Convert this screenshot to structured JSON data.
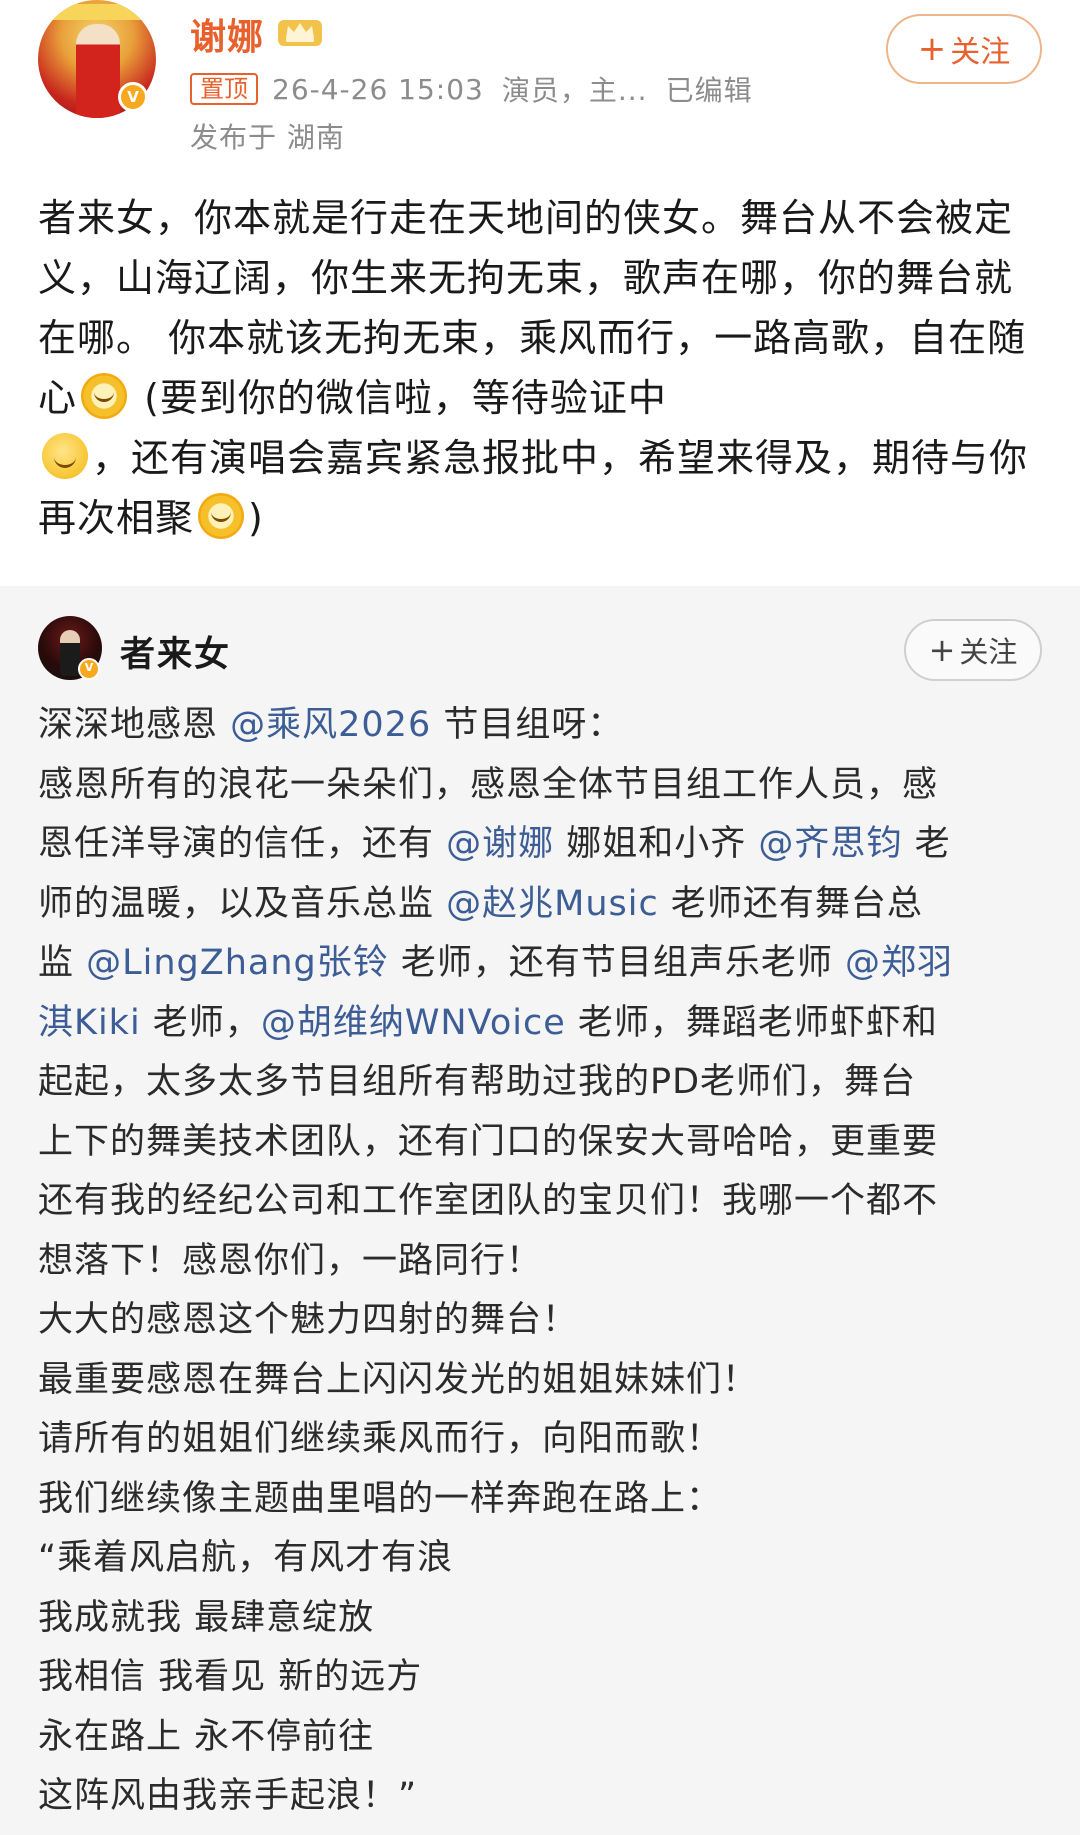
{
  "post": {
    "username": "谢娜",
    "pin_label": "置顶",
    "timestamp": "26-4-26 15:03",
    "tagline": "演员，主...",
    "edited_label": "已编辑",
    "location": "发布于 湖南",
    "follow_label": "关注",
    "follow_plus": "+",
    "body": {
      "seg1": "者来女，你本就是行走在天地间的侠女。舞台从不会被定义，山海辽阔，你生来无拘无束，歌声在哪，你的舞台就在哪。 你本就该无拘无束，乘风而行，一路高歌，自在随心",
      "seg2": " (要到你的微信啦，等待验证中",
      "seg3": "，还有演唱会嘉宾紧急报批中，希望来得及，期待与你再次相聚",
      "seg4": ")"
    },
    "emoji": [
      "sun-emoji",
      "smile-emoji",
      "sun-emoji"
    ],
    "colors": {
      "name": "#e8612c",
      "meta": "#8c8c8c",
      "badge": "#f8a81e"
    }
  },
  "repost": {
    "username": "者来女",
    "follow_label": "关注",
    "follow_plus": "+",
    "colors": {
      "background": "#f5f5f5",
      "mention": "#3c5d95"
    },
    "lines": [
      {
        "t1": "深深地感恩 ",
        "m1": "@乘风2026",
        "t2": " 节目组呀："
      },
      {
        "t1": "感恩所有的浪花一朵朵们，感恩全体节目组工作人员，感"
      },
      {
        "t1": "恩任洋导演的信任，还有 ",
        "m1": "@谢娜",
        "t2": " 娜姐和小齐 ",
        "m2": "@齐思钧",
        "t3": " 老"
      },
      {
        "t1": "师的温暖，以及音乐总监 ",
        "m1": "@赵兆Music",
        "t2": " 老师还有舞台总"
      },
      {
        "t1": "监 ",
        "m1": "@LingZhang张铃",
        "t2": " 老师，还有节目组声乐老师 ",
        "m2": "@郑羽"
      },
      {
        "m1": "淇Kiki",
        "t1": " 老师，",
        "m2": "@胡维纳WNVoice",
        "t2": " 老师，舞蹈老师虾虾和"
      },
      {
        "t1": "起起，太多太多节目组所有帮助过我的PD老师们，舞台"
      },
      {
        "t1": "上下的舞美技术团队，还有门口的保安大哥哈哈，更重要"
      },
      {
        "t1": "还有我的经纪公司和工作室团队的宝贝们！我哪一个都不"
      },
      {
        "t1": "想落下！感恩你们，一路同行！"
      },
      {
        "t1": "大大的感恩这个魅力四射的舞台！"
      },
      {
        "t1": "最重要感恩在舞台上闪闪发光的姐姐妹妹们！"
      },
      {
        "t1": "请所有的姐姐们继续乘风而行，向阳而歌！"
      },
      {
        "t1": "我们继续像主题曲里唱的一样奔跑在路上："
      },
      {
        "t1": "“乘着风启航，有风才有浪"
      },
      {
        "t1": "我成就我 最肆意绽放"
      },
      {
        "t1": "我相信 我看见 新的远方"
      },
      {
        "t1": "永在路上 永不停前往"
      },
      {
        "t1": "这阵风由我亲手起浪！”"
      }
    ]
  }
}
